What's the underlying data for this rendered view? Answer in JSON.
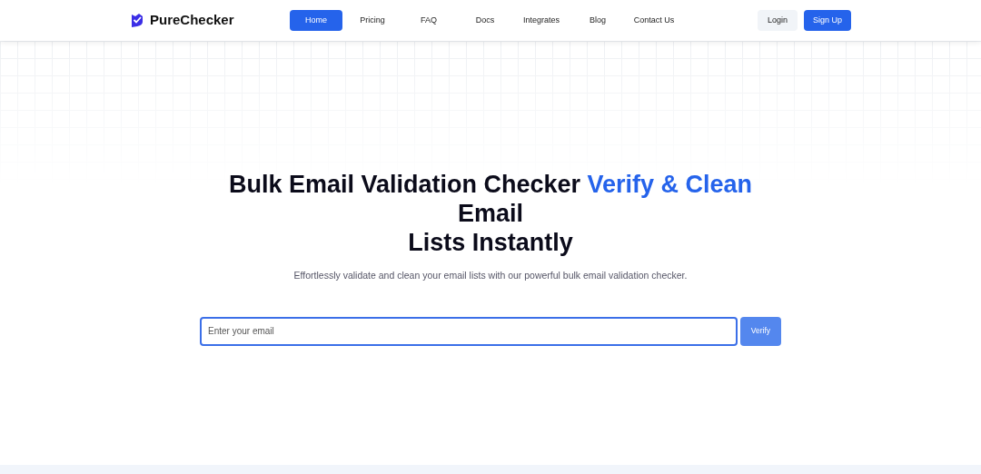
{
  "brand": {
    "name": "PureChecker"
  },
  "nav": [
    {
      "label": "Home",
      "selected": true
    },
    {
      "label": "Pricing",
      "selected": false
    },
    {
      "label": "FAQ",
      "selected": false
    },
    {
      "label": "Docs",
      "selected": false
    },
    {
      "label": "Integrates",
      "selected": false
    },
    {
      "label": "Blog",
      "selected": false
    },
    {
      "label": "Contact Us",
      "selected": false
    }
  ],
  "auth": {
    "login": "Login",
    "signup": "Sign Up"
  },
  "hero": {
    "heading_lines": [
      [
        {
          "text": "Bulk Email Validation Checker ",
          "highlight": false
        },
        {
          "text": "Verify & Clean",
          "highlight": true
        }
      ],
      [
        {
          "text": "Email",
          "highlight": false
        }
      ],
      [
        {
          "text": "Lists Instantly",
          "highlight": false
        }
      ]
    ],
    "subtitle": "Effortlessly validate and clean your email lists with our powerful bulk email validation checker.",
    "email_field": {
      "placeholder": "Enter your email"
    },
    "verify_button": "Verify"
  }
}
